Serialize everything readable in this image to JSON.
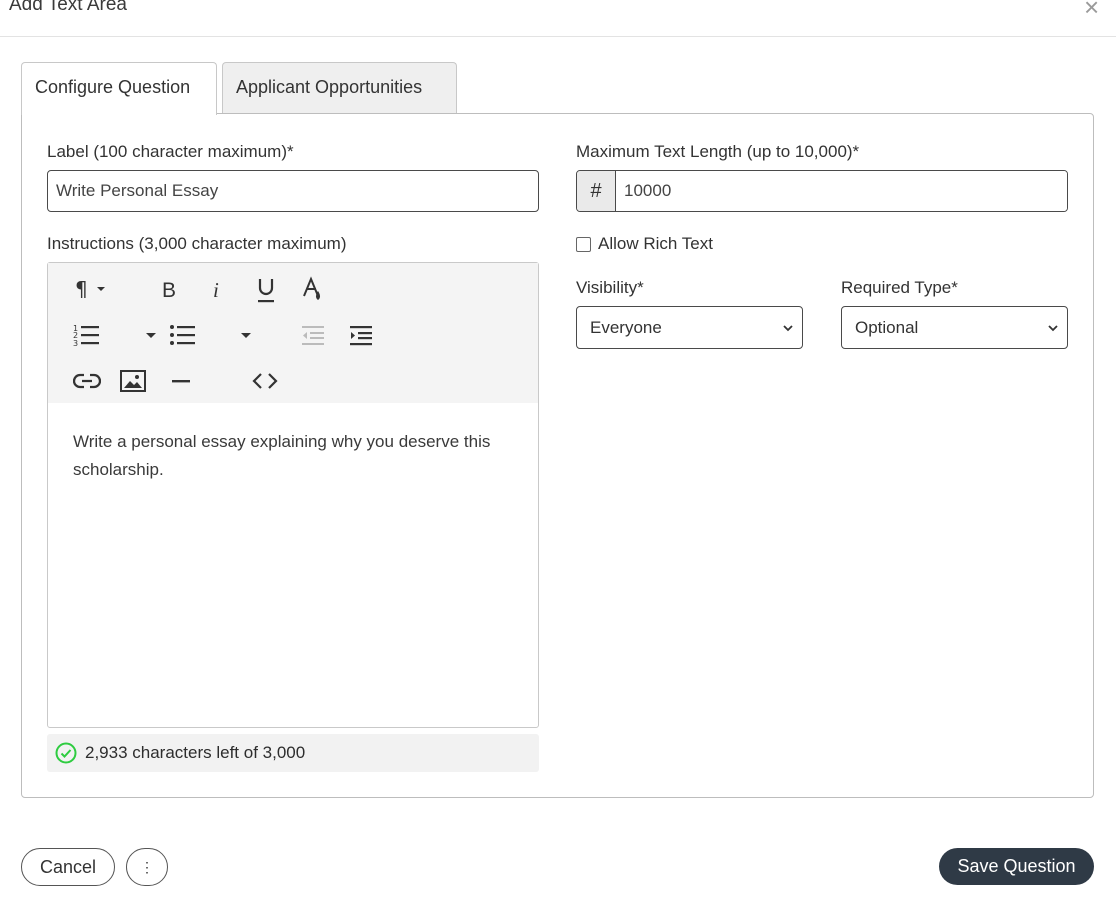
{
  "dialog": {
    "title": "Add Text Area",
    "close_symbol": "×"
  },
  "tabs": [
    {
      "label": "Configure Question",
      "active": true
    },
    {
      "label": "Applicant Opportunities",
      "active": false
    }
  ],
  "form": {
    "label_field": {
      "label": "Label (100 character maximum)*",
      "value": "Write Personal Essay"
    },
    "instructions": {
      "label": "Instructions (3,000 character maximum)",
      "content": "Write a personal essay explaining why you deserve this scholarship.",
      "counter": "2,933 characters left of 3,000",
      "toolbar_icons": [
        "paragraph-icon",
        "bold-icon",
        "italic-icon",
        "underline-icon",
        "font-color-icon",
        "numbered-list-icon",
        "bulleted-list-icon",
        "outdent-icon",
        "indent-icon",
        "link-icon",
        "image-icon",
        "horizontal-rule-icon",
        "code-view-icon"
      ]
    },
    "max_length": {
      "label": "Maximum Text Length (up to 10,000)*",
      "prefix": "#",
      "value": "10000"
    },
    "rich_text": {
      "label": "Allow Rich Text",
      "checked": false
    },
    "visibility": {
      "label": "Visibility*",
      "value": "Everyone"
    },
    "required_type": {
      "label": "Required Type*",
      "value": "Optional"
    }
  },
  "footer": {
    "cancel_label": "Cancel",
    "more_symbol": "⋮",
    "save_label": "Save Question"
  },
  "colors": {
    "primary_button": "#2f3a46",
    "success": "#2ecc40"
  }
}
